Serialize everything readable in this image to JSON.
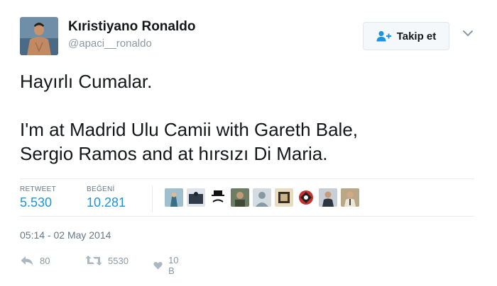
{
  "author": {
    "display_name": "Kıristiyano Ronaldo",
    "screen_name": "@apaci__ronaldo",
    "avatar_icon": "profile-photo-icon"
  },
  "follow_button": {
    "label": "Takip et",
    "icon": "add-user-icon"
  },
  "more_menu": {
    "icon": "chevron-down-icon"
  },
  "tweet": {
    "lines": [
      "Hayırlı Cumalar.",
      "I'm at Madrid Ulu Camii with Gareth Bale,",
      "Sergio Ramos and at hırsızı Di Maria."
    ]
  },
  "stats": {
    "retweet_label": "RETWEET",
    "retweet_value": "5.530",
    "like_label": "BEĞENİ",
    "like_value": "10.281"
  },
  "likers": [
    {
      "name": "liker-avatar-1",
      "color": "#6a9bb0"
    },
    {
      "name": "liker-avatar-2",
      "color": "#2f3b48"
    },
    {
      "name": "liker-avatar-3",
      "color": "#ffffff"
    },
    {
      "name": "liker-avatar-4",
      "color": "#5b6b54"
    },
    {
      "name": "liker-avatar-5",
      "color": "#b9c4cc"
    },
    {
      "name": "liker-avatar-6",
      "color": "#d8c9a8"
    },
    {
      "name": "liker-avatar-7",
      "color": "#c9302c"
    },
    {
      "name": "liker-avatar-8",
      "color": "#4b5560"
    },
    {
      "name": "liker-avatar-9",
      "color": "#8a7a5a"
    }
  ],
  "timestamp": "05:14 - 02 May 2014",
  "actions": {
    "reply_count": "80",
    "retweet_count": "5530",
    "like_count": "10 B"
  },
  "colors": {
    "accent": "#1b95e0",
    "text": "#14171a",
    "muted": "#657786"
  }
}
